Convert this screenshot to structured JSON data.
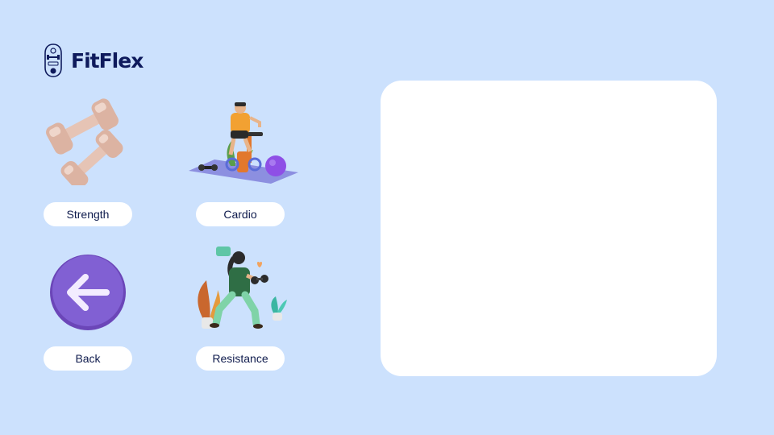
{
  "app": {
    "brand_name": "FitFlex",
    "logo_icon": "badge-dumbbell-icon"
  },
  "menu": {
    "items": [
      {
        "id": "strength",
        "label": "Strength",
        "icon": "dumbbells-icon"
      },
      {
        "id": "cardio",
        "label": "Cardio",
        "icon": "exercise-bike-person-icon"
      },
      {
        "id": "back",
        "label": "Back",
        "icon": "back-arrow-icon"
      },
      {
        "id": "resistance",
        "label": "Resistance",
        "icon": "lunge-with-dumbbell-person-icon"
      }
    ]
  },
  "colors": {
    "background": "#cce1fd",
    "brand_text": "#0e1a5c",
    "button_bg": "#ffffff",
    "button_text": "#0f1b4d",
    "panel_bg": "#ffffff",
    "accent_purple": "#7e5bd0"
  }
}
